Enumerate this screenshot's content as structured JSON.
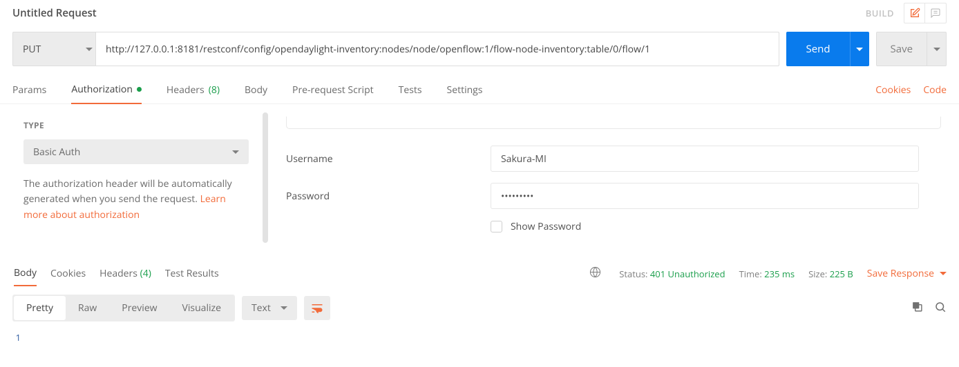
{
  "request": {
    "title": "Untitled Request",
    "build": "BUILD",
    "method": "PUT",
    "url": "http://127.0.0.1:8181/restconf/config/opendaylight-inventory:nodes/node/openflow:1/flow-node-inventory:table/0/flow/1",
    "send": "Send",
    "save": "Save"
  },
  "tabs": {
    "params": "Params",
    "authorization": "Authorization",
    "headers": "Headers",
    "headers_count": "(8)",
    "body": "Body",
    "prerequest": "Pre-request Script",
    "tests": "Tests",
    "settings": "Settings",
    "cookies": "Cookies",
    "code": "Code"
  },
  "auth": {
    "type_label": "TYPE",
    "type_value": "Basic Auth",
    "help_text": "The authorization header will be automatically generated when you send the request. ",
    "help_link": "Learn more about authorization",
    "username_label": "Username",
    "username_value": "Sakura-MI",
    "password_label": "Password",
    "password_value": "•••••••••",
    "show_password": "Show Password"
  },
  "response": {
    "tabs": {
      "body": "Body",
      "cookies": "Cookies",
      "headers": "Headers",
      "headers_count": "(4)",
      "test_results": "Test Results"
    },
    "status_label": "Status:",
    "status_value": "401 Unauthorized",
    "time_label": "Time:",
    "time_value": "235 ms",
    "size_label": "Size:",
    "size_value": "225 B",
    "save_response": "Save Response"
  },
  "viewer": {
    "pretty": "Pretty",
    "raw": "Raw",
    "preview": "Preview",
    "visualize": "Visualize",
    "format": "Text",
    "line_no": "1"
  }
}
